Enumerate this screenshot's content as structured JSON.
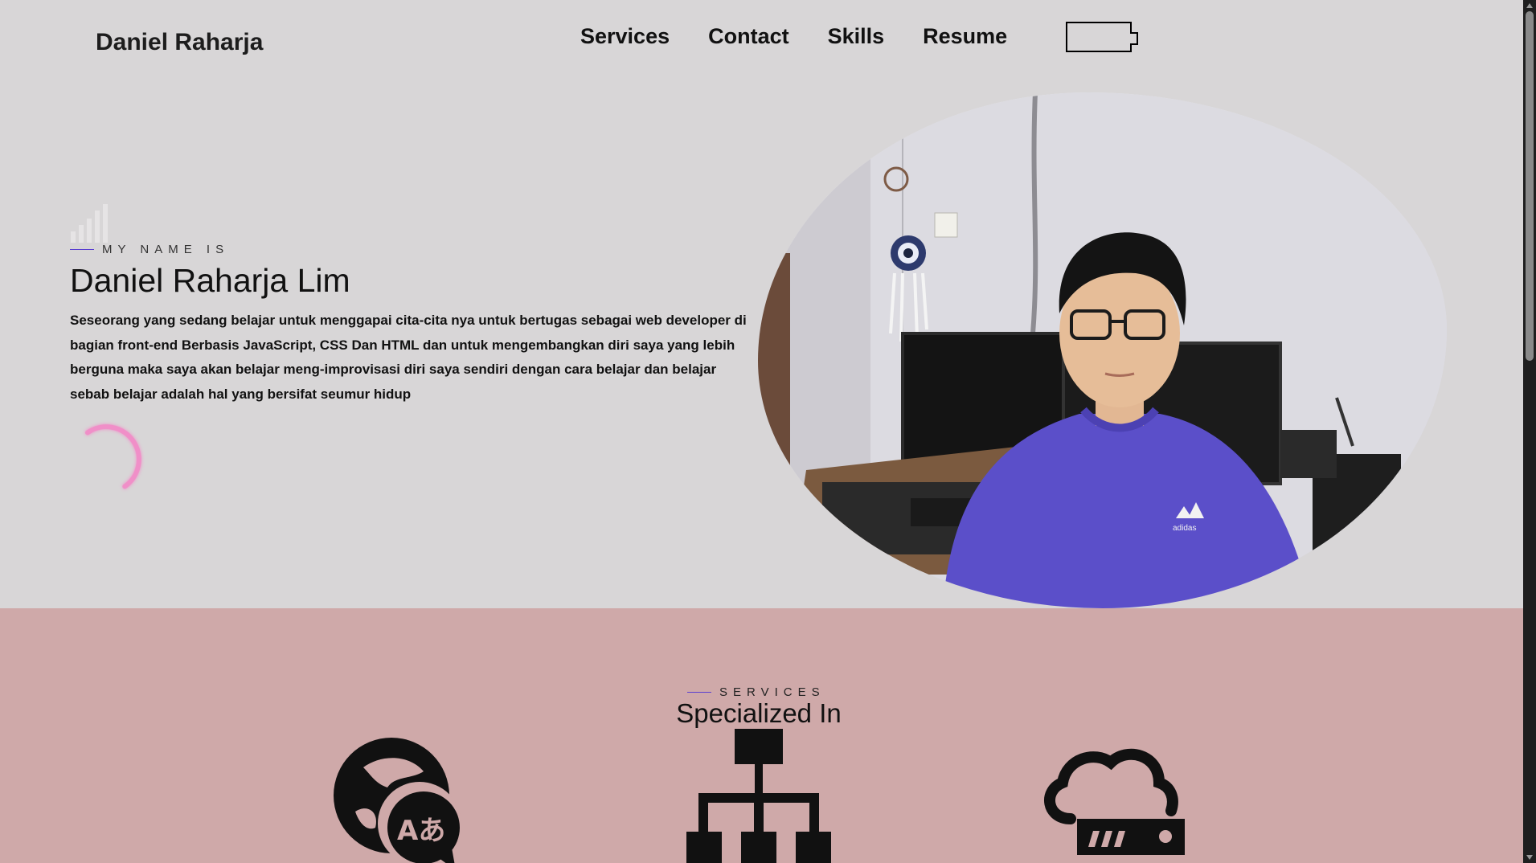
{
  "header": {
    "logo": "Daniel Raharja",
    "nav": [
      "Services",
      "Contact",
      "Skills",
      "Resume"
    ]
  },
  "hero": {
    "eyebrow": "MY NAME IS",
    "name": "Daniel Raharja Lim",
    "description": "Seseorang yang sedang belajar untuk menggapai cita-cita nya untuk bertugas sebagai web developer di bagian front-end Berbasis JavaScript, CSS Dan HTML dan untuk mengembangkan diri saya yang lebih berguna maka saya akan belajar meng-improvisasi diri saya sendiri dengan cara belajar dan belajar sebab belajar adalah hal yang bersifat seumur hidup",
    "shirt_logo": "adidas"
  },
  "services": {
    "eyebrow": "SERVICES",
    "title": "Specialized In",
    "icon_glyph": "Aあ",
    "icons": [
      "globe-translate-icon",
      "sitemap-icon",
      "cloud-router-icon"
    ]
  },
  "colors": {
    "background": "#d8d6d7",
    "services_bg": "#cfa9a9",
    "accent_line": "#5a3fd0",
    "spinner": "#f08fc8",
    "shirt": "#5b4fc9"
  }
}
